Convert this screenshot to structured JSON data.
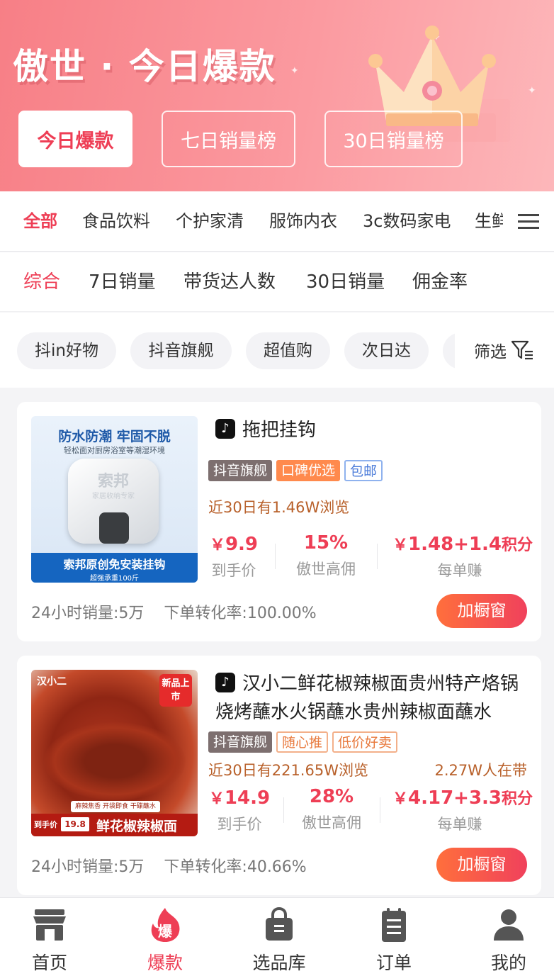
{
  "header": {
    "title": "傲世 · 今日爆款",
    "rank_tabs": [
      {
        "label": "今日爆款",
        "active": true
      },
      {
        "label": "七日销量榜",
        "active": false
      },
      {
        "label": "30日销量榜",
        "active": false
      }
    ]
  },
  "categories": {
    "items": [
      "全部",
      "食品饮料",
      "个护家清",
      "服饰内衣",
      "3c数码家电",
      "生鲜"
    ],
    "active_index": 0,
    "menu_icon": "hamburger-menu-icon"
  },
  "sort": {
    "items": [
      "综合",
      "7日销量",
      "带货达人数",
      "30日销量",
      "佣金率"
    ],
    "active_index": 0
  },
  "filters": {
    "chips": [
      "抖in好物",
      "抖音旗舰",
      "超值购",
      "次日达",
      ""
    ],
    "filter_label": "筛选"
  },
  "products": [
    {
      "title": "拖把挂钩",
      "platform_icon": "douyin-icon",
      "tags": [
        {
          "text": "抖音旗舰",
          "style": "dark"
        },
        {
          "text": "口碑优选",
          "style": "orange"
        },
        {
          "text": "包邮",
          "style": "blue"
        }
      ],
      "views": "近30日有1.46W浏览",
      "in_bring": "",
      "price": "9.9",
      "price_label": "到手价",
      "commission_rate": "15%",
      "commission_label": "傲世高佣",
      "earn": "1.48+1.4",
      "earn_suffix": "积分",
      "earn_label": "每单赚",
      "sales_24h": "24小时销量:5万",
      "conversion": "下单转化率:100.00%",
      "button_label": "加橱窗",
      "image": {
        "headline": "防水防潮 牢固不脱",
        "sub": "轻松面对厨房浴室等潮湿环境",
        "brand": "索邦",
        "brand_sub": "家居收纳专家",
        "banner": "索邦原创免安装挂钩",
        "banner_sub": "超强承重100斤"
      }
    },
    {
      "title": "汉小二鲜花椒辣椒面贵州特产烙锅烧烤蘸水火锅蘸水贵州辣椒面蘸水",
      "platform_icon": "douyin-icon",
      "tags": [
        {
          "text": "抖音旗舰",
          "style": "dark"
        },
        {
          "text": "随心推",
          "style": "ol"
        },
        {
          "text": "低价好卖",
          "style": "ol"
        }
      ],
      "views": "近30日有221.65W浏览",
      "in_bring": "2.27W人在带",
      "price": "14.9",
      "price_label": "到手价",
      "commission_rate": "28%",
      "commission_label": "傲世高佣",
      "earn": "4.17+3.3",
      "earn_suffix": "积分",
      "earn_label": "每单赚",
      "sales_24h": "24小时销量:5万",
      "conversion": "下单转化率:40.66%",
      "button_label": "加橱窗",
      "image": {
        "brand": "汉小二",
        "badge": "新品上市",
        "slogan": "麻辣焦香 开袋即食 干碟蘸水",
        "price_tag": "到手价",
        "price_value": "19.8",
        "banner": "鲜花椒辣椒面"
      }
    }
  ],
  "bottom_nav": [
    {
      "label": "首页",
      "icon": "store-icon",
      "active": false
    },
    {
      "label": "爆款",
      "icon": "hot-flame-icon",
      "icon_text": "爆",
      "active": true
    },
    {
      "label": "选品库",
      "icon": "shopping-bag-icon",
      "active": false
    },
    {
      "label": "订单",
      "icon": "order-clipboard-icon",
      "active": false
    },
    {
      "label": "我的",
      "icon": "user-icon",
      "active": false
    }
  ],
  "colors": {
    "accent": "#ee3e55",
    "header": "#f77f86",
    "button": "#ff6f3c"
  }
}
